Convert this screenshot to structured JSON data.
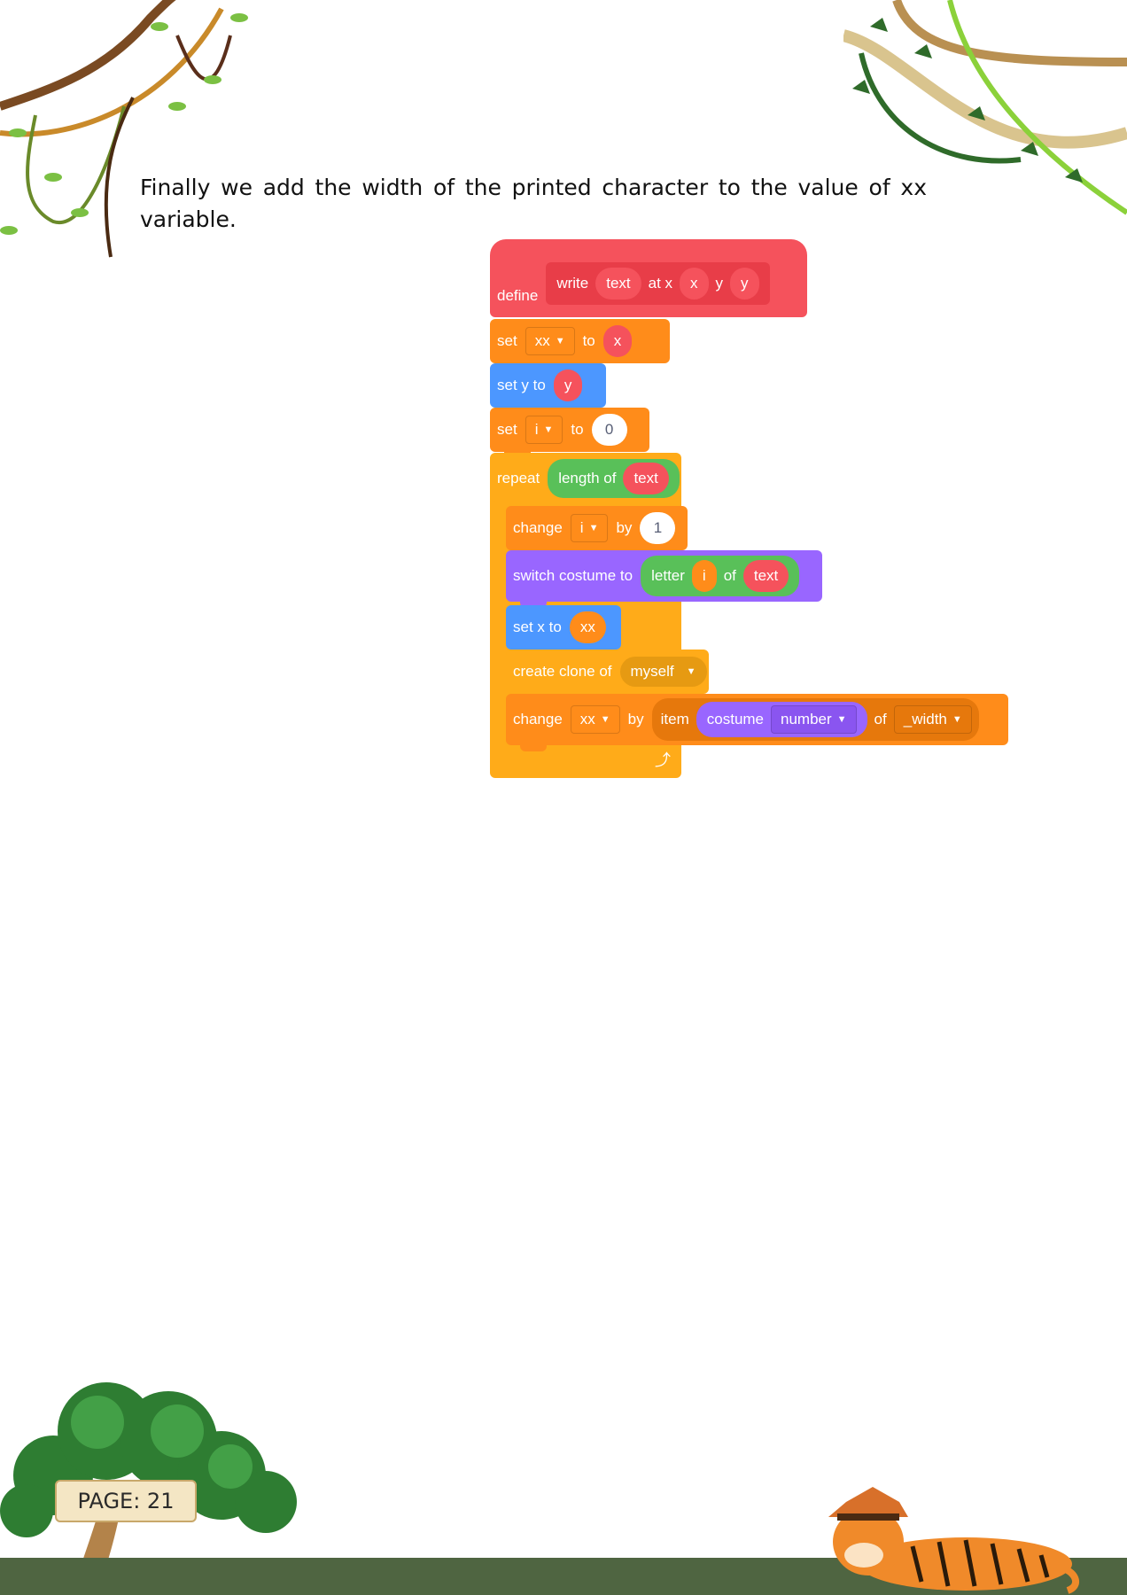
{
  "intro_text": "Finally we add the width of the printed character to the value of xx variable.",
  "page_label": "PAGE: 21",
  "icons": {
    "top_left": "jungle-vines-icon",
    "top_right": "jungle-vines-icon",
    "bottom_left": "tree-icon",
    "bottom_right": "tiger-icon",
    "loop_arrow": "loop-arrow-icon"
  },
  "colors": {
    "my_blocks": "#f5525c",
    "variables": "#ff8c1a",
    "motion": "#4c97ff",
    "control": "#ffab19",
    "operators": "#59c059",
    "looks": "#9966ff",
    "ground": "#4f6541"
  },
  "scratch": {
    "define": {
      "keyword": "define",
      "name": "write",
      "arg1": "text",
      "at_x": "at x",
      "arg2": "x",
      "y_label": "y",
      "arg3": "y"
    },
    "set_xx": {
      "keyword": "set",
      "var": "xx",
      "to": "to",
      "value": "x"
    },
    "set_y": {
      "label": "set y to",
      "value": "y"
    },
    "set_i": {
      "keyword": "set",
      "var": "i",
      "to": "to",
      "value": "0"
    },
    "repeat": {
      "keyword": "repeat",
      "op": "length of",
      "arg": "text"
    },
    "change_i": {
      "keyword": "change",
      "var": "i",
      "by": "by",
      "value": "1"
    },
    "switch_costume": {
      "label": "switch costume to",
      "op": "letter",
      "arg1": "i",
      "of": "of",
      "arg2": "text"
    },
    "set_x": {
      "label": "set x to",
      "value": "xx"
    },
    "create_clone": {
      "label": "create clone of",
      "value": "myself"
    },
    "change_xx": {
      "keyword": "change",
      "var": "xx",
      "by": "by",
      "item": "item",
      "costume": "costume",
      "costume_opt": "number",
      "of": "of",
      "list": "_width"
    }
  }
}
